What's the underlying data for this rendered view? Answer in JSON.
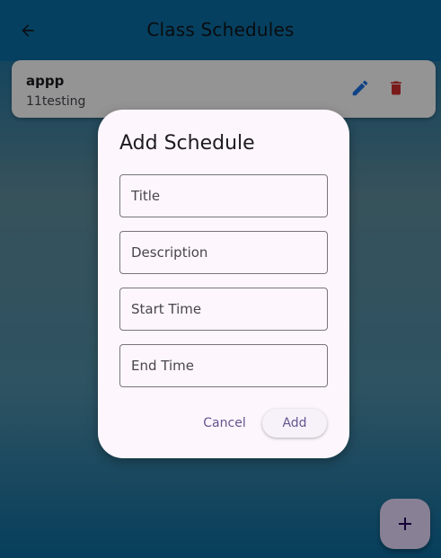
{
  "appbar": {
    "title": "Class Schedules",
    "back_icon": "arrow-back-icon"
  },
  "schedule_list": [
    {
      "title": "appp",
      "subtitle": "11testing",
      "edit_icon": "pencil-icon",
      "delete_icon": "trash-icon"
    }
  ],
  "dialog": {
    "title": "Add Schedule",
    "fields": {
      "title": {
        "placeholder": "Title",
        "value": ""
      },
      "description": {
        "placeholder": "Description",
        "value": ""
      },
      "start_time": {
        "placeholder": "Start Time",
        "value": ""
      },
      "end_time": {
        "placeholder": "End Time",
        "value": ""
      }
    },
    "cancel_label": "Cancel",
    "add_label": "Add"
  },
  "fab": {
    "icon": "plus-icon"
  },
  "colors": {
    "appbar": "#0b6ea6",
    "accent_text": "#65558f",
    "edit_icon": "#1a73e8",
    "delete_icon": "#d32f2f",
    "fab": "#eaddff",
    "dialog_bg": "#fdf6fd"
  }
}
